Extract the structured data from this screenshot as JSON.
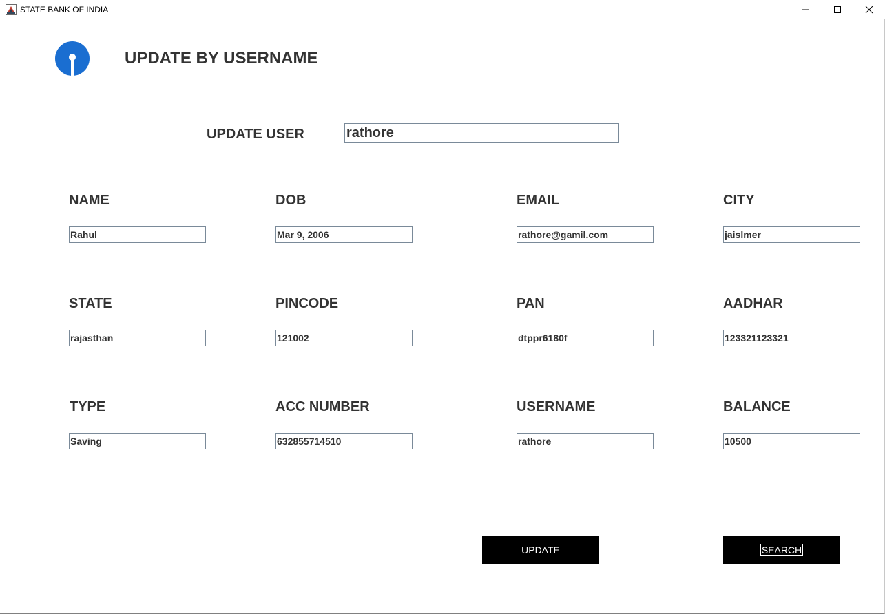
{
  "window": {
    "title": "STATE BANK OF INDIA",
    "icons": {
      "app": "java-cup-icon",
      "minimize": "minimize-icon",
      "maximize": "maximize-icon",
      "close": "close-icon"
    }
  },
  "brand": {
    "logo_icon": "sbi-logo-icon",
    "logo_color": "#1a6ed1"
  },
  "page": {
    "heading": "UPDATE BY USERNAME"
  },
  "search": {
    "label": "UPDATE USER",
    "value": "rathore"
  },
  "fields": [
    {
      "label": "NAME",
      "value": "Rahul"
    },
    {
      "label": "DOB",
      "value": "Mar 9, 2006"
    },
    {
      "label": "EMAIL",
      "value": "rathore@gamil.com"
    },
    {
      "label": "CITY",
      "value": "jaislmer"
    },
    {
      "label": "STATE",
      "value": "rajasthan"
    },
    {
      "label": "PINCODE",
      "value": "121002"
    },
    {
      "label": "PAN",
      "value": "dtppr6180f"
    },
    {
      "label": "AADHAR",
      "value": "123321123321"
    },
    {
      "label": "TYPE",
      "value": "Saving"
    },
    {
      "label": "ACC NUMBER",
      "value": "632855714510"
    },
    {
      "label": "USERNAME",
      "value": "rathore"
    },
    {
      "label": "BALANCE",
      "value": "10500"
    }
  ],
  "actions": {
    "update_label": "UPDATE",
    "search_label": "SEARCH"
  }
}
